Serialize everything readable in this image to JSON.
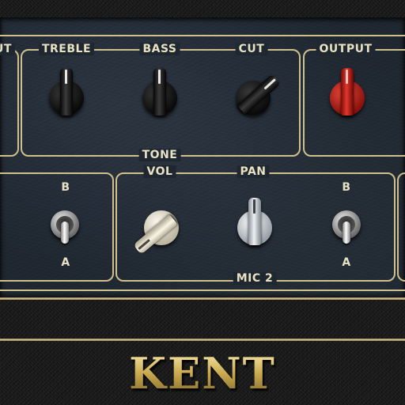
{
  "amp": {
    "brand_logo": "KENT",
    "tone_section": {
      "partial_left_label": "UT",
      "group_label": "TONE",
      "knobs": [
        {
          "label": "TREBLE",
          "color": "black"
        },
        {
          "label": "BASS",
          "color": "black"
        },
        {
          "label": "CUT",
          "color": "black"
        }
      ]
    },
    "output": {
      "label": "OUTPUT",
      "color": "red"
    },
    "mic1": {
      "switch_top_label": "B",
      "switch_bottom_label": "A",
      "position": "A"
    },
    "mic2": {
      "group_label": "MIC 2",
      "vol_label": "VOL",
      "pan_label": "PAN",
      "vol_color": "cream",
      "pan_color": "silver",
      "switch_top_label": "B",
      "switch_bottom_label": "A",
      "position": "A"
    }
  },
  "colors": {
    "panel": "#1f2731",
    "gold_trim": "#cfc08e",
    "label_text": "#e9e1c4",
    "output_knob": "#d8261c"
  }
}
